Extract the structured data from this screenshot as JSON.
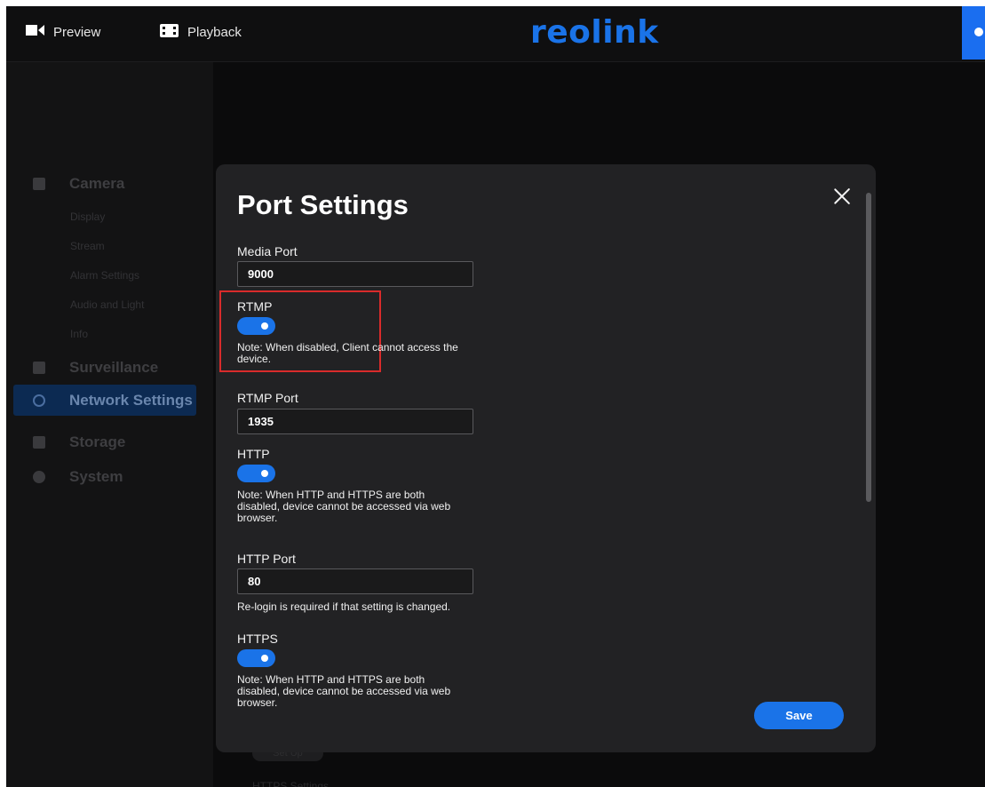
{
  "topbar": {
    "preview_label": "Preview",
    "playback_label": "Playback",
    "logo_text": "reolink",
    "accent_color": "#1a73e8"
  },
  "sidebar": {
    "groups": [
      {
        "label": "Camera",
        "icon": "camera-icon"
      },
      {
        "label": "Surveillance",
        "icon": "monitor-icon"
      },
      {
        "label": "Network Settings",
        "icon": "globe-icon",
        "active": true
      },
      {
        "label": "Storage",
        "icon": "storage-icon"
      },
      {
        "label": "System",
        "icon": "gear-icon"
      }
    ],
    "camera_sub": [
      "Display",
      "Stream",
      "Alarm Settings",
      "Audio and Light",
      "Info"
    ]
  },
  "background": {
    "button_label": "Set Up",
    "section_label": "HTTPS Settings"
  },
  "modal": {
    "title": "Port Settings",
    "media_port": {
      "label": "Media Port",
      "value": "9000"
    },
    "rtmp": {
      "label": "RTMP",
      "enabled": true,
      "note": "Note: When disabled, Client cannot access the device."
    },
    "rtmp_port": {
      "label": "RTMP Port",
      "value": "1935"
    },
    "http": {
      "label": "HTTP",
      "enabled": true,
      "note": "Note: When HTTP and HTTPS are both disabled, device cannot be accessed via web browser."
    },
    "http_port": {
      "label": "HTTP Port",
      "value": "80",
      "note": "Re-login is required if that setting is changed."
    },
    "https": {
      "label": "HTTPS",
      "enabled": true,
      "note": "Note: When HTTP and HTTPS are both disabled, device cannot be accessed via web browser."
    },
    "save_label": "Save"
  }
}
